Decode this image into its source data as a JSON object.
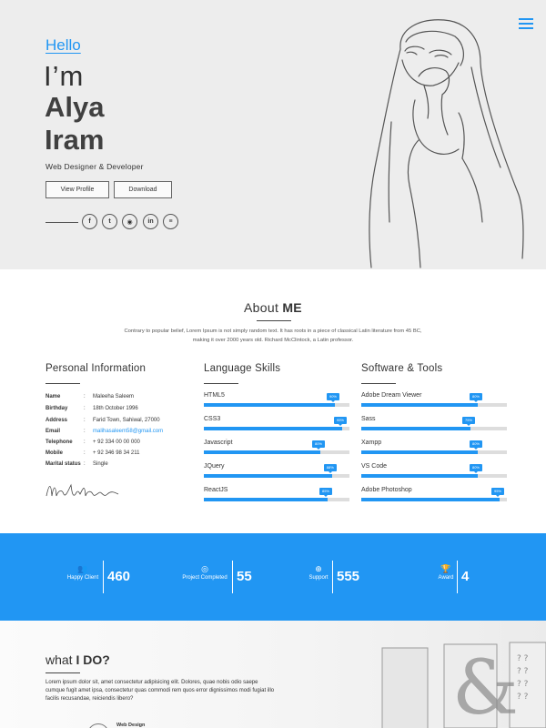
{
  "hero": {
    "hello": "Hello",
    "im": "I’m",
    "first_name": "Alya",
    "last_name": "Iram",
    "role": "Web Designer & Developer",
    "view_profile": "View Profile",
    "download": "Download",
    "social": [
      {
        "icon": "facebook-icon",
        "glyph": "f"
      },
      {
        "icon": "twitter-icon",
        "glyph": "t"
      },
      {
        "icon": "github-icon",
        "glyph": "◉"
      },
      {
        "icon": "linkedin-icon",
        "glyph": "in"
      },
      {
        "icon": "stackoverflow-icon",
        "glyph": "≡"
      }
    ]
  },
  "about": {
    "title_a": "About ",
    "title_b": "ME",
    "text": "Contrary to popular belief, Lorem Ipsum is not simply random text. It has roots in a piece of classical Latin literature from 45 BC, making it over 2000 years old. Richard McClintock, a Latin professor."
  },
  "personal": {
    "title": "Personal Information",
    "rows": [
      {
        "k": "Name",
        "v": "Maleeha Saleem"
      },
      {
        "k": "Birthday",
        "v": "18th October 1996"
      },
      {
        "k": "Address",
        "v": "Farid Town, Sahiwal, 27000"
      },
      {
        "k": "Email",
        "v": "malihasaleem58@gmail.com"
      },
      {
        "k": "Telephone",
        "v": "+ 92 334 00 00 000"
      },
      {
        "k": "Mobile",
        "v": "+ 92 346 98 34 211"
      },
      {
        "k": "Marital status",
        "v": "Single"
      }
    ]
  },
  "languages": {
    "title": "Language Skills",
    "items": [
      {
        "name": "HTML5",
        "percent": 90,
        "label": "90%"
      },
      {
        "name": "CSS3",
        "percent": 95,
        "label": "95%"
      },
      {
        "name": "Javascript",
        "percent": 80,
        "label": "80%"
      },
      {
        "name": "JQuery",
        "percent": 88,
        "label": "88%"
      },
      {
        "name": "ReactJS",
        "percent": 85,
        "label": "85%"
      }
    ]
  },
  "software": {
    "title": "Software & Tools",
    "items": [
      {
        "name": "Adobe Dream Viewer",
        "percent": 80,
        "label": "80%"
      },
      {
        "name": "Sass",
        "percent": 75,
        "label": "75%"
      },
      {
        "name": "Xampp",
        "percent": 80,
        "label": "80%"
      },
      {
        "name": "VS Code",
        "percent": 80,
        "label": "80%"
      },
      {
        "name": "Adobe Photoshop",
        "percent": 95,
        "label": "95%"
      }
    ]
  },
  "stats": [
    {
      "icon": "users-icon",
      "glyph": "👥",
      "label": "Happy Client",
      "value": "460"
    },
    {
      "icon": "eye-icon",
      "glyph": "◎",
      "label": "Project Completed",
      "value": "55"
    },
    {
      "icon": "globe-icon",
      "glyph": "⊕",
      "label": "Support",
      "value": "555"
    },
    {
      "icon": "trophy-icon",
      "glyph": "🏆",
      "label": "Award",
      "value": "4"
    }
  ],
  "whatido": {
    "title_a": "what ",
    "title_b": "I DO?",
    "text": "Lorem ipsum dolor sit, amet consectetur adipisicing elit. Dolores, quae nobis odio saepe cumque fugit amet ipsa, consectetur quas commodi rem quos error dignissimos modi fugiat illo facilis recusandae, reiciendis libero?",
    "first_service": "Web Design"
  },
  "colors": {
    "accent": "#2196f3",
    "hero_bg": "#ededed",
    "bar_track": "#dddddd"
  }
}
